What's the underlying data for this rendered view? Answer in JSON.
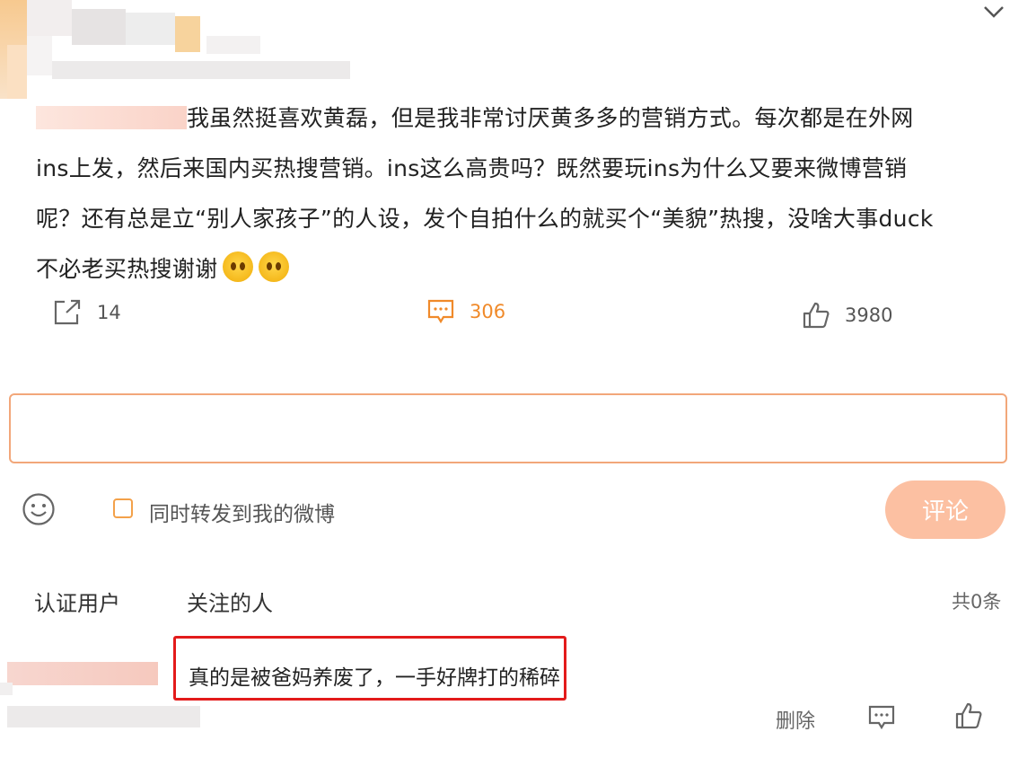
{
  "post": {
    "text_line1": "我虽然挺喜欢黄磊，但是我非常讨厌黄多多的营销方式。每次都是在外网",
    "text_line2": "ins上发，然后来国内买热搜营销。ins这么高贵吗？既然要玩ins为什么又要来微博营销",
    "text_line3": "呢？还有总是立“别人家孩子”的人设，发个自拍什么的就买个“美貌”热搜，没啥大事duck",
    "text_line4": "不必老买热搜谢谢"
  },
  "actions": {
    "share_count": "14",
    "comment_count": "306",
    "like_count": "3980"
  },
  "composer": {
    "input_value": "",
    "repost_label": "同时转发到我的微博",
    "submit_label": "评论"
  },
  "tabs": {
    "verified": "认证用户",
    "following": "关注的人"
  },
  "comment_total": "共0条",
  "reply": {
    "text": "真的是被爸妈养废了，一手好牌打的稀碎",
    "delete_label": "删除"
  },
  "colors": {
    "accent": "#f08a2a",
    "input_border": "#f2a77a",
    "submit_bg": "#fcc0a2",
    "highlight": "#e31b1b"
  },
  "icons": {
    "share": "share-icon",
    "comment": "comment-icon",
    "like": "thumbs-up-icon",
    "emoji": "smiley-icon",
    "chevron": "chevron-down-icon"
  }
}
